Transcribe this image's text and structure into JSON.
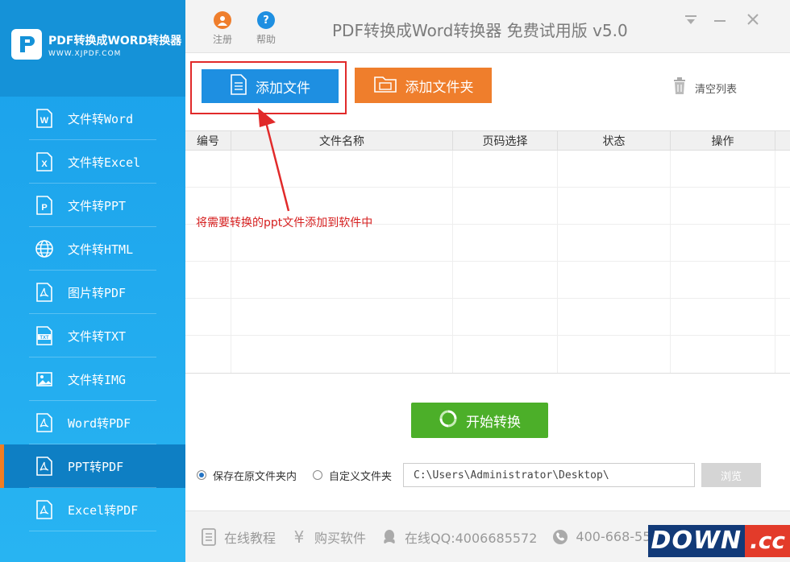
{
  "logo": {
    "title": "PDF转换成WORD转换器",
    "url": "WWW.XJPDF.COM"
  },
  "sidebar": {
    "items": [
      {
        "label": "文件转Word",
        "icon": "W"
      },
      {
        "label": "文件转Excel",
        "icon": "X"
      },
      {
        "label": "文件转PPT",
        "icon": "P"
      },
      {
        "label": "文件转HTML",
        "icon": "globe"
      },
      {
        "label": "图片转PDF",
        "icon": "pdf"
      },
      {
        "label": "文件转TXT",
        "icon": "TXT"
      },
      {
        "label": "文件转IMG",
        "icon": "img"
      },
      {
        "label": "Word转PDF",
        "icon": "pdf"
      },
      {
        "label": "PPT转PDF",
        "icon": "pdf"
      },
      {
        "label": "Excel转PDF",
        "icon": "pdf"
      }
    ]
  },
  "titlebar": {
    "register_label": "注册",
    "help_label": "帮助",
    "title": "PDF转换成Word转换器 免费试用版 v5.0"
  },
  "toolbar": {
    "add_file_label": "添加文件",
    "add_folder_label": "添加文件夹",
    "clear_list_label": "清空列表"
  },
  "table": {
    "headers": [
      "编号",
      "文件名称",
      "页码选择",
      "状态",
      "操作"
    ]
  },
  "annotation": "将需要转换的ppt文件添加到软件中",
  "start_label": "开始转换",
  "save": {
    "option_original": "保存在原文件夹内",
    "option_custom": "自定义文件夹",
    "path": "C:\\Users\\Administrator\\Desktop\\",
    "browse_label": "浏览"
  },
  "footer": {
    "tutorial": "在线教程",
    "buy": "购买软件",
    "qq": "在线QQ:4006685572",
    "phone": "400-668-55"
  },
  "watermark": {
    "left": "DOWN",
    "right": ".cc"
  },
  "colors": {
    "sidebar": "#1aa0ea",
    "active_item": "#0e7fc4",
    "add_file": "#1e8fe1",
    "add_folder": "#ef7e2c",
    "start": "#4caf29",
    "annotation": "#d62020"
  }
}
